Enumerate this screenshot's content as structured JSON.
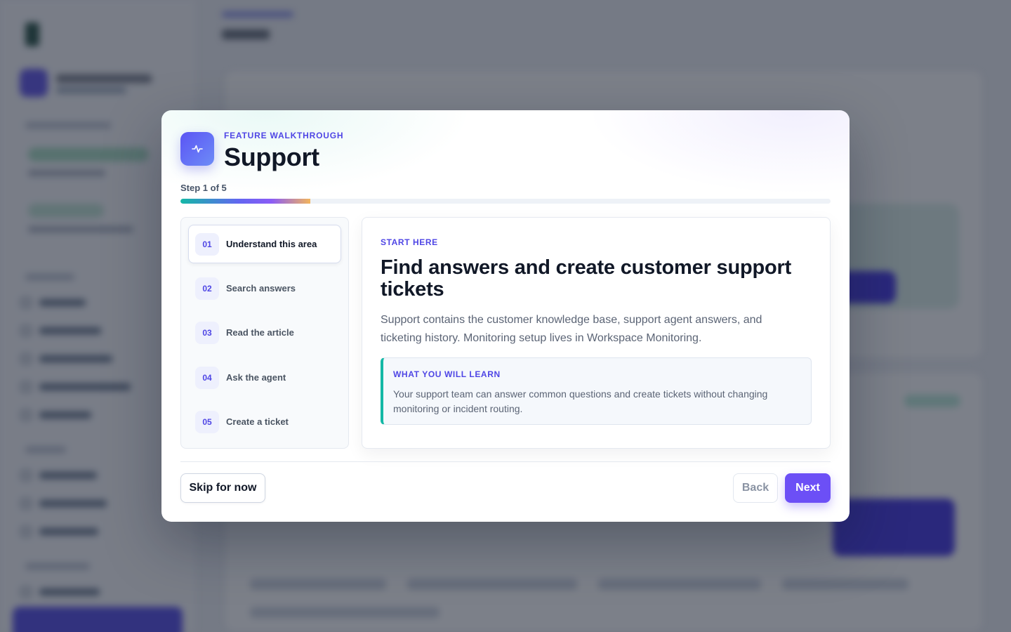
{
  "modal": {
    "eyebrow": "FEATURE WALKTHROUGH",
    "title": "Support",
    "step_indicator": "Step 1 of 5",
    "progress": 0.2,
    "icon": "activity-pulse-icon",
    "steps": [
      {
        "num": "01",
        "label": "Understand this area",
        "active": true
      },
      {
        "num": "02",
        "label": "Search answers",
        "active": false
      },
      {
        "num": "03",
        "label": "Read the article",
        "active": false
      },
      {
        "num": "04",
        "label": "Ask the agent",
        "active": false
      },
      {
        "num": "05",
        "label": "Create a ticket",
        "active": false
      }
    ],
    "content": {
      "eyebrow": "START HERE",
      "title": "Find answers and create customer support tickets",
      "body": "Support contains the customer knowledge base, support agent answers, and ticketing history. Monitoring setup lives in Workspace Monitoring.",
      "learn_label": "WHAT YOU WILL LEARN",
      "learn_text": "Your support team can answer common questions and create tickets without changing monitoring or incident routing."
    },
    "buttons": {
      "skip": "Skip for now",
      "back": "Back",
      "next": "Next"
    }
  },
  "colors": {
    "accent": "#4f46e5",
    "next_button": "#6c4ff6",
    "teal": "#14b8a6"
  }
}
